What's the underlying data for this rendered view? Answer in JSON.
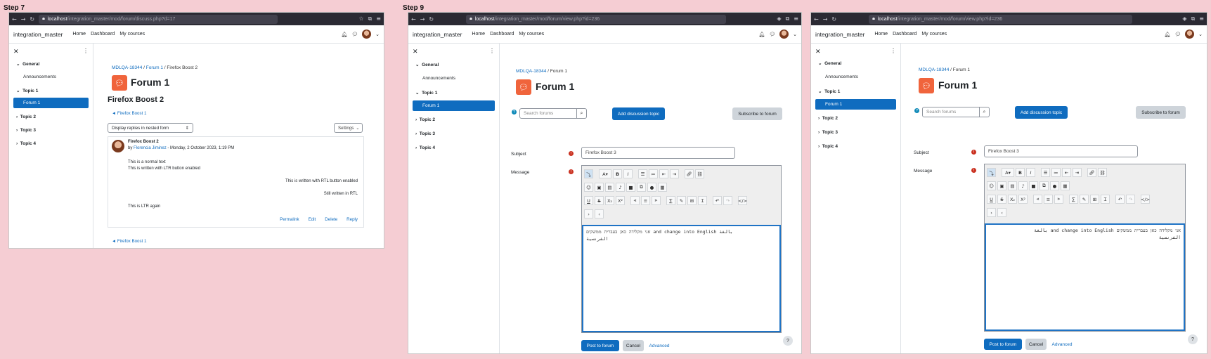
{
  "steps": {
    "step7": "Step 7",
    "step9": "Step 9"
  },
  "site_name": "integration_master",
  "nav_links": [
    "Home",
    "Dashboard",
    "My courses"
  ],
  "drawer": {
    "items": [
      "General",
      "Announcements",
      "Topic 1",
      "Forum 1",
      "Topic 2",
      "Topic 3",
      "Topic 4"
    ]
  },
  "win1": {
    "url_host": "localhost",
    "url_path": "/integration_master/mod/forum/discuss.php?d=17",
    "breadcrumb": [
      "MDLQA-18344",
      "Forum 1",
      "Firefox Boost 2"
    ],
    "forum_title": "Forum 1",
    "discussion_title": "Firefox Boost 2",
    "back_link": "◄ Firefox Boost 1",
    "display_mode": "Display replies in nested form",
    "settings": "Settings",
    "post": {
      "title": "Firefox Boost 2",
      "by": "by",
      "author": "Florencia Jiminez",
      "date": " - Monday, 2 October 2023, 1:19 PM",
      "lines": [
        "This is a normal text",
        "This is written with LTR button enabled",
        "This is written with RTL button enabled",
        "Still written in RTL",
        "This is LTR again"
      ],
      "actions": [
        "Permalink",
        "Edit",
        "Delete",
        "Reply"
      ]
    },
    "bottom_link": "◄ Firefox Boost 1"
  },
  "win2": {
    "url_host": "localhost",
    "url_path": "/integration_master/mod/forum/view.php?id=236",
    "breadcrumb": [
      "MDLQA-18344",
      "Forum 1"
    ],
    "forum_title": "Forum 1",
    "search_placeholder": "Search forums",
    "add_topic": "Add discussion topic",
    "subscribe": "Subscribe to forum",
    "subject_label": "Subject",
    "subject_value": "Firefox Boost 3",
    "message_label": "Message",
    "editor_line1": "אני מקלידה כאן בעברית ממשקים and change into English بالغة",
    "editor_line2": "الفرنسية",
    "post_btn": "Post to forum",
    "cancel_btn": "Cancel",
    "advanced": "Advanced"
  },
  "win3": {
    "url_host": "localhost",
    "url_path": "/integration_master/mod/forum/view.php?id=236",
    "breadcrumb": [
      "MDLQA-18344",
      "Forum 1"
    ],
    "forum_title": "Forum 1",
    "search_placeholder": "Search forums",
    "add_topic": "Add discussion topic",
    "subscribe": "Subscribe to forum",
    "subject_label": "Subject",
    "subject_value": "Firefox Boost 3",
    "message_label": "Message",
    "editor_line1": "אני מקלידה כאן בעברית ממשקים and change into English بالغة",
    "editor_line2": "الفرنسية",
    "post_btn": "Post to forum",
    "cancel_btn": "Cancel",
    "advanced": "Advanced"
  }
}
